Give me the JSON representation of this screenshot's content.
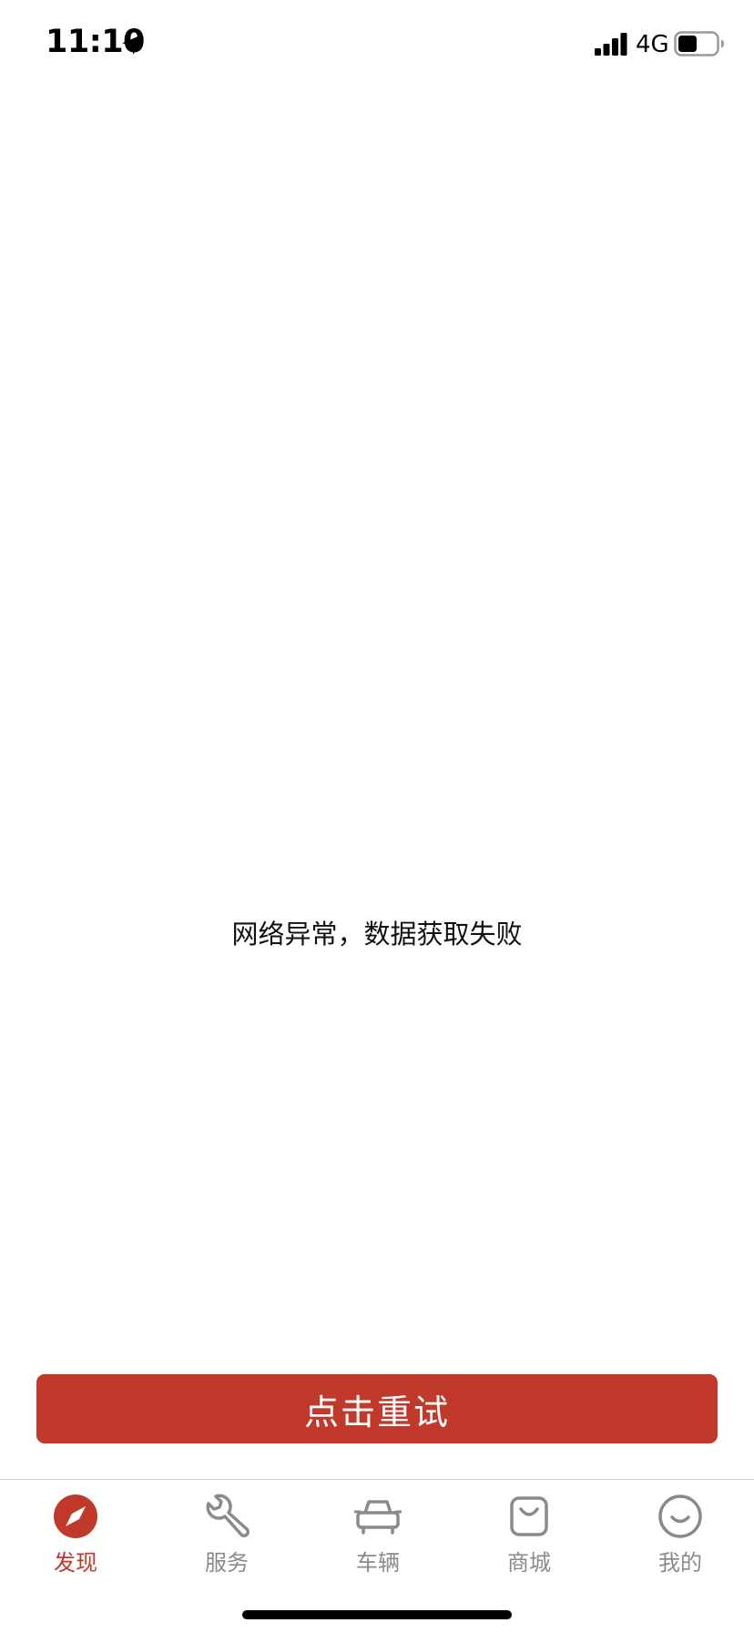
{
  "status_bar": {
    "time": "11:10",
    "network": "4G"
  },
  "main": {
    "error_message": "网络异常，数据获取失败",
    "retry_label": "点击重试"
  },
  "tab_bar": {
    "items": [
      {
        "label": "发现",
        "icon": "compass-icon",
        "active": true
      },
      {
        "label": "服务",
        "icon": "wrench-icon",
        "active": false
      },
      {
        "label": "车辆",
        "icon": "car-icon",
        "active": false
      },
      {
        "label": "商城",
        "icon": "shopping-bag-icon",
        "active": false
      },
      {
        "label": "我的",
        "icon": "smiley-icon",
        "active": false
      }
    ]
  },
  "colors": {
    "accent": "#c0392b",
    "inactive_tab": "#8a8a8a"
  }
}
